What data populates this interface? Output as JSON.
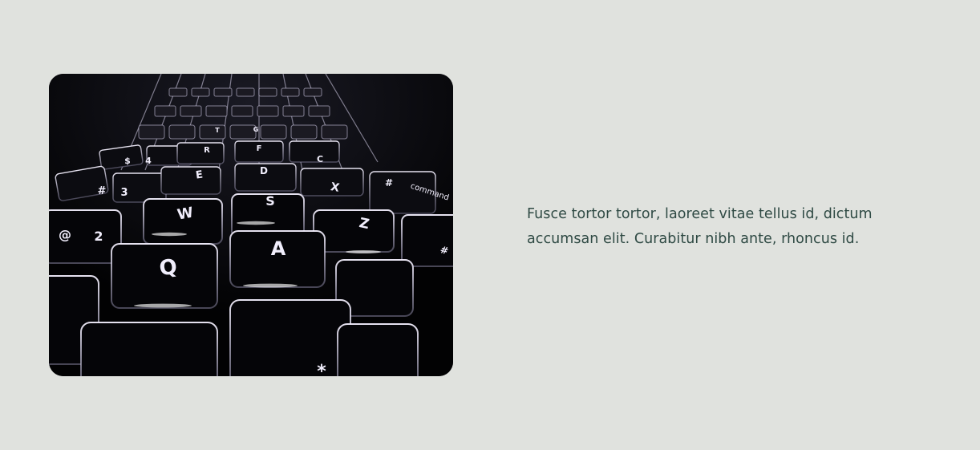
{
  "photo": {
    "subject": "backlit-keyboard",
    "key_legends": [
      "Q",
      "W",
      "E",
      "R",
      "T",
      "A",
      "S",
      "D",
      "F",
      "G",
      "Z",
      "X",
      "C",
      "2",
      "3",
      "4",
      "@",
      "#",
      "$",
      "command"
    ]
  },
  "body_text": "Fusce tortor tortor, laoreet vitae tellus id, dictum accumsan elit. Curabitur nibh ante, rhoncus id.",
  "colors": {
    "background": "#e0e2de",
    "text": "#2f4a44",
    "photo_base": "#030304",
    "key_glow": "#e6e2f4"
  }
}
